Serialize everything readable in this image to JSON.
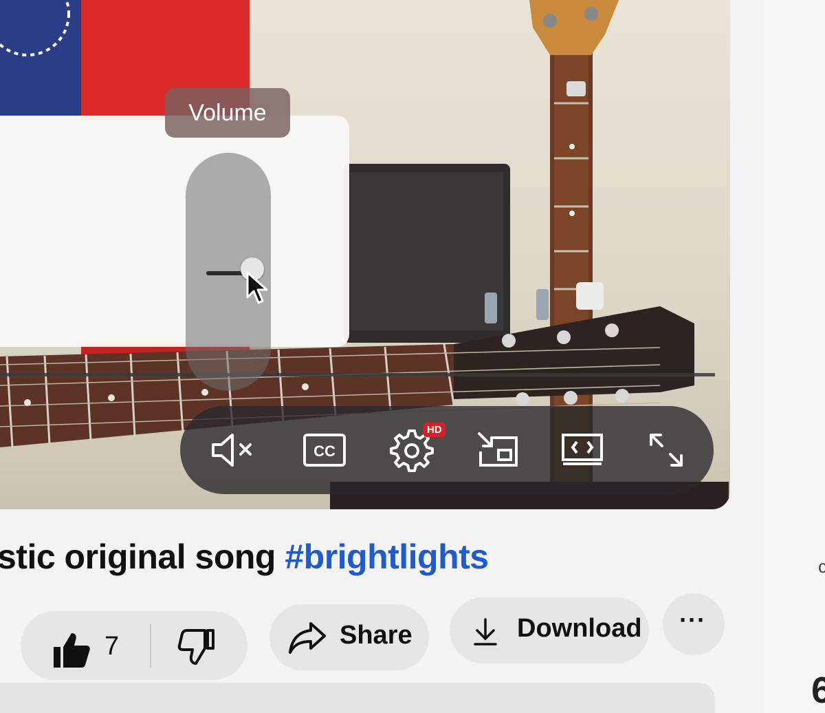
{
  "player": {
    "volume_tooltip": "Volume",
    "volume_level": 0.55,
    "controls": {
      "mute_icon": "volume-muted-icon",
      "captions_icon": "closed-captions-icon",
      "settings_icon": "settings-gear-icon",
      "settings_badge": "HD",
      "miniplayer_icon": "miniplayer-icon",
      "theater_icon": "theater-mode-icon",
      "fullscreen_icon": "fullscreen-icon"
    },
    "badge_color": "#d4202a"
  },
  "video": {
    "title_text": "stic original song ",
    "hashtag": "#brightlights",
    "hashtag_color": "#1e5bd0"
  },
  "actions": {
    "like_count": "7",
    "share_label": "Share",
    "download_label": "Download",
    "more_label": "···"
  },
  "sidebar": {
    "edge_text": "6",
    "edge_small": "c"
  }
}
